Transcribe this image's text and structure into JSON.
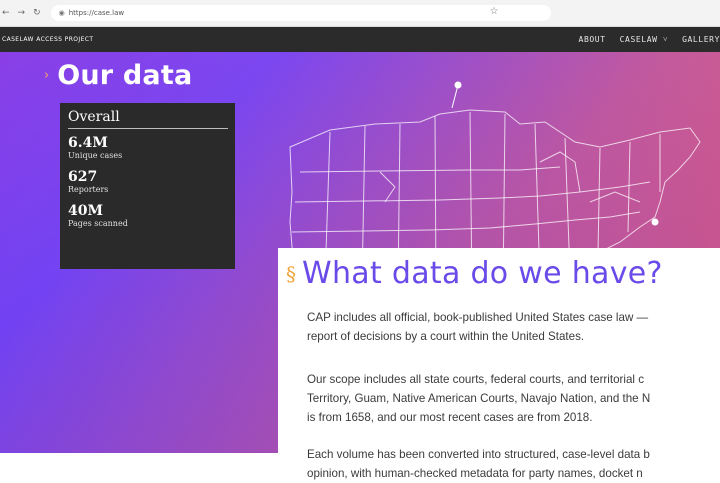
{
  "browser": {
    "back_icon": "back-arrow-icon",
    "forward_icon": "forward-arrow-icon",
    "reload_icon": "reload-icon",
    "url": "https://case.law",
    "star_icon": "star-icon"
  },
  "site": {
    "brand": "CASELAW ACCESS PROJECT",
    "nav": [
      {
        "label": "ABOUT"
      },
      {
        "label": "CASELAW ˅"
      },
      {
        "label": "GALLERY"
      }
    ]
  },
  "hero": {
    "title": "Our data",
    "stats_heading": "Overall",
    "stats": [
      {
        "value": "6.4M",
        "label": "Unique cases"
      },
      {
        "value": "627",
        "label": "Reporters"
      },
      {
        "value": "40M",
        "label": "Pages scanned"
      }
    ]
  },
  "content": {
    "heading": "What data do we have?",
    "section_symbol": "§",
    "paragraphs": [
      [
        "CAP includes all official, book-published United States case law —",
        "report of decisions by a court within the United States."
      ],
      [
        "Our scope includes all state courts, federal courts, and territorial c",
        "Territory, Guam, Native American Courts, Navajo Nation, and the N",
        "is from 1658, and our most recent cases are from 2018."
      ],
      [
        "Each volume has been converted into structured, case-level data b",
        "opinion, with human-checked metadata for party names, docket n"
      ]
    ]
  },
  "colors": {
    "gradient_start": "#8a3fe6",
    "gradient_end": "#ec5c6a",
    "heading_purple": "#6a4ae8",
    "accent_orange": "#f1a43a",
    "nav_dark": "#2b2b2b"
  }
}
